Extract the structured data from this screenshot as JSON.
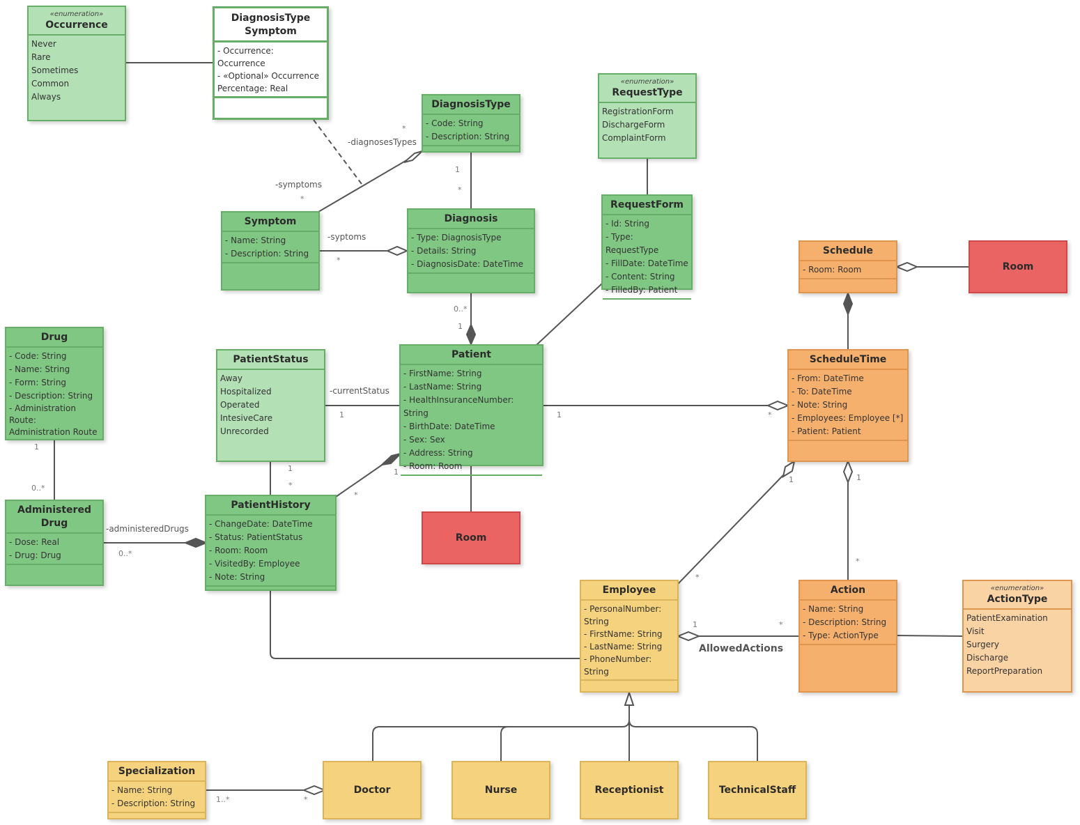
{
  "classes": {
    "occurrence": {
      "stereotype": "«enumeration»",
      "name": "Occurrence",
      "literals": [
        "Never",
        "Rare",
        "Sometimes",
        "Common",
        "Always"
      ]
    },
    "diagnosisTypeSymptom": {
      "name": "DiagnosisType\nSymptom",
      "name_line1": "DiagnosisType",
      "name_line2": "Symptom",
      "attributes": [
        "- Occurrence: Occurrence",
        "- «Optional» Occurrence Percentage: Real"
      ]
    },
    "diagnosisType": {
      "name": "DiagnosisType",
      "attributes": [
        "- Code: String",
        "- Description: String"
      ]
    },
    "requestType": {
      "stereotype": "«enumeration»",
      "name": "RequestType",
      "literals": [
        "RegistrationForm",
        "DischargeForm",
        "ComplaintForm"
      ]
    },
    "symptom": {
      "name": "Symptom",
      "attributes": [
        "- Name: String",
        "- Description: String"
      ]
    },
    "diagnosis": {
      "name": "Diagnosis",
      "attributes": [
        "- Type: DiagnosisType",
        "- Details: String",
        "- DiagnosisDate: DateTime"
      ]
    },
    "requestForm": {
      "name": "RequestForm",
      "attributes": [
        "- Id: String",
        "- Type: RequestType",
        "- FillDate: DateTime",
        "- Content: String",
        "- FilledBy: Patient"
      ]
    },
    "schedule": {
      "name": "Schedule",
      "attributes": [
        "- Room: Room"
      ]
    },
    "roomSchedule": {
      "name": "Room"
    },
    "drug": {
      "name": "Drug",
      "attributes": [
        "- Code: String",
        "- Name: String",
        "- Form: String",
        "- Description: String",
        "- Administration Route: Administration Route"
      ]
    },
    "patientStatus": {
      "name": "PatientStatus",
      "literals": [
        "Away",
        "Hospitalized",
        "Operated",
        "IntesiveCare",
        "Unrecorded"
      ]
    },
    "patient": {
      "name": "Patient",
      "attributes": [
        "- FirstName: String",
        "- LastName: String",
        "- HealthInsuranceNumber: String",
        "- BirthDate: DateTime",
        "- Sex: Sex",
        "- Address: String",
        "- Room: Room"
      ]
    },
    "scheduleTime": {
      "name": "ScheduleTime",
      "attributes": [
        "- From: DateTime",
        "- To: DateTime",
        "- Note: String",
        "- Employees: Employee [*]",
        "- Patient: Patient"
      ]
    },
    "administeredDrug": {
      "name": "Administered Drug",
      "attributes": [
        "- Dose: Real",
        "- Drug: Drug"
      ]
    },
    "patientHistory": {
      "name": "PatientHistory",
      "attributes": [
        "- ChangeDate: DateTime",
        "- Status: PatientStatus",
        "- Room: Room",
        "- VisitedBy: Employee",
        "- Note: String"
      ]
    },
    "roomPatient": {
      "name": "Room"
    },
    "employee": {
      "name": "Employee",
      "attributes": [
        "- PersonalNumber: String",
        "- FirstName: String",
        "- LastName: String",
        "- PhoneNumber: String"
      ]
    },
    "action": {
      "name": "Action",
      "attributes": [
        "- Name: String",
        "- Description: String",
        "- Type: ActionType"
      ]
    },
    "actionType": {
      "stereotype": "«enumeration»",
      "name": "ActionType",
      "literals": [
        "PatientExamination",
        "Visit",
        "Surgery",
        "Discharge",
        "ReportPreparation"
      ]
    },
    "specialization": {
      "name": "Specialization",
      "attributes": [
        "- Name: String",
        "- Description: String"
      ]
    },
    "doctor": {
      "name": "Doctor"
    },
    "nurse": {
      "name": "Nurse"
    },
    "receptionist": {
      "name": "Receptionist"
    },
    "technicalStaff": {
      "name": "TechnicalStaff"
    }
  },
  "labels": {
    "diagnosesTypes": "-diagnosesTypes",
    "diagnosesTypesMult": "*",
    "symptoms": "-symptoms",
    "symptomsMult": "*",
    "syptoms": "-syptoms",
    "syptomsMult": "*",
    "dtDiag1": "1",
    "dtDiagStar": "*",
    "diagPat0n": "0..*",
    "diagPat1": "1",
    "currentStatus": "-currentStatus",
    "currentStatus1": "1",
    "patSched1": "1",
    "patSchedStar": "*",
    "drug1": "1",
    "drug0n": "0..*",
    "administeredDrugs": "-administeredDrugs",
    "administeredDrugs0n": "0..*",
    "psHist1": "1",
    "psHistStar": "*",
    "phPat1": "1",
    "phPatStar": "*",
    "empSt1": "1",
    "empStStar": "*",
    "actSt1": "1",
    "actStStar": "*",
    "empAct1": "1",
    "empActStar": "*",
    "allowedActions": "AllowedActions",
    "spec1n": "1..*",
    "specStar": "*"
  }
}
